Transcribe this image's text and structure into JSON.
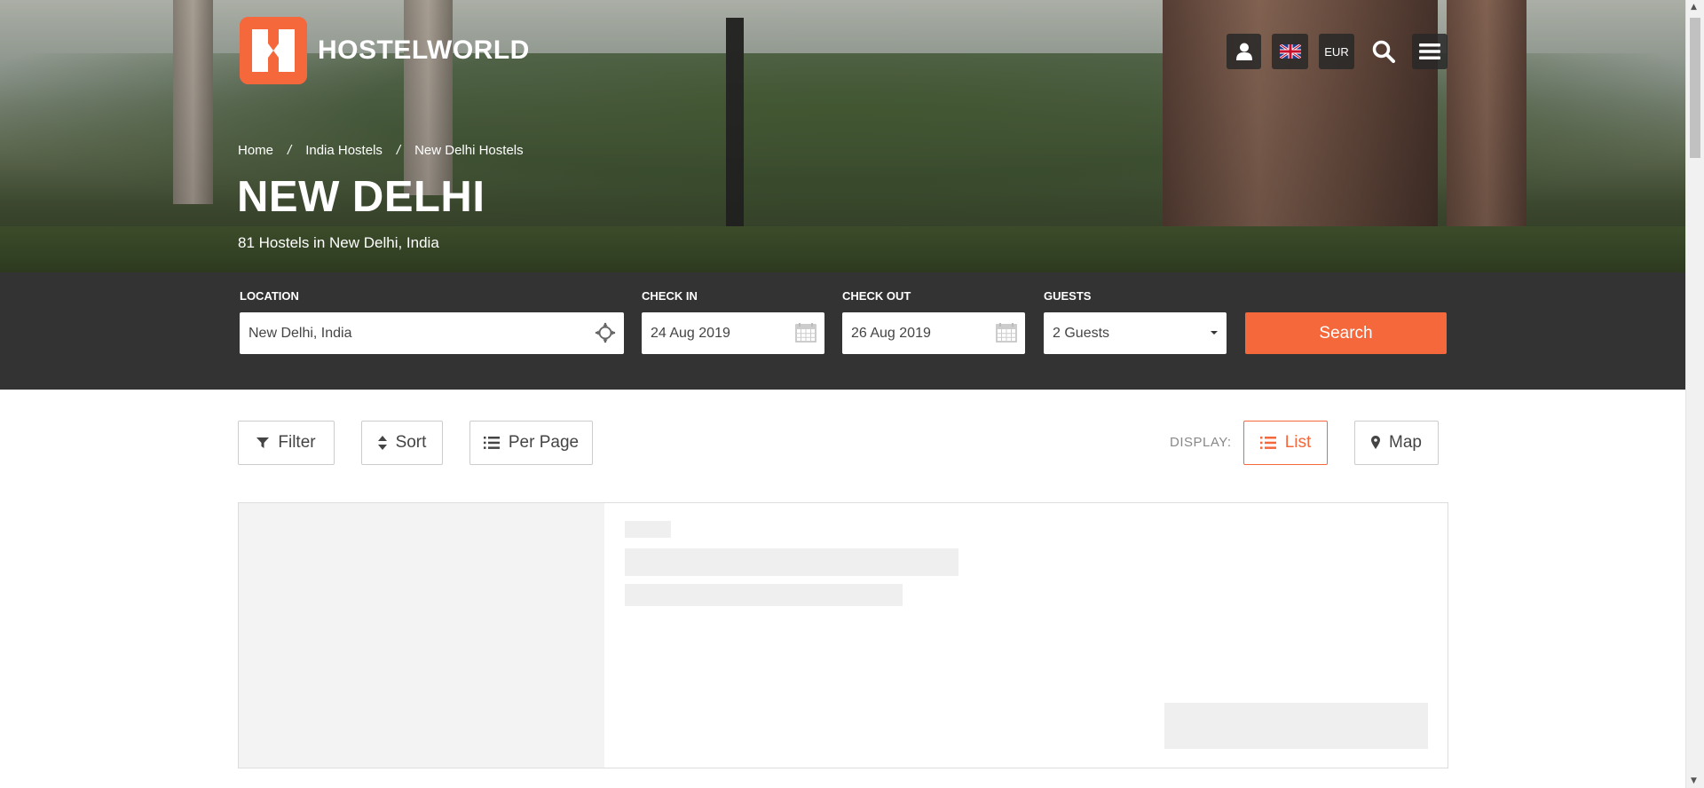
{
  "brand": {
    "name": "HOSTELWORLD",
    "accent": "#f4683b"
  },
  "header": {
    "currency": "EUR",
    "icons": [
      "user-icon",
      "uk-flag-icon",
      "search-icon",
      "menu-icon"
    ]
  },
  "breadcrumb": {
    "items": [
      "Home",
      "India Hostels",
      "New Delhi Hostels"
    ],
    "separator": "/"
  },
  "page": {
    "title": "NEW DELHI",
    "subtitle": "81 Hostels in New Delhi, India"
  },
  "search": {
    "location_label": "LOCATION",
    "location_value": "New Delhi, India",
    "checkin_label": "CHECK IN",
    "checkin_value": "24 Aug 2019",
    "checkout_label": "CHECK OUT",
    "checkout_value": "26 Aug 2019",
    "guests_label": "GUESTS",
    "guests_value": "2 Guests",
    "button_label": "Search"
  },
  "toolbar": {
    "filter_label": "Filter",
    "sort_label": "Sort",
    "per_page_label": "Per Page",
    "display_label": "DISPLAY:",
    "list_label": "List",
    "map_label": "Map",
    "active_view": "List"
  }
}
